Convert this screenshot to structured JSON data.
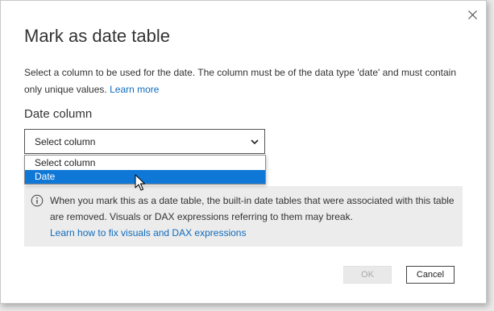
{
  "dialog": {
    "title": "Mark as date table",
    "description": "Select a column to be used for the date. The column must be of the data type 'date' and must contain only unique values.",
    "learn_more": "Learn more",
    "close_icon": "close-icon"
  },
  "date_column": {
    "label": "Date column",
    "selected_value": "Select column",
    "options": [
      "Select column",
      "Date"
    ],
    "highlighted_option": "Date"
  },
  "info": {
    "icon": "info-icon",
    "text": "When you mark this as a date table, the built-in date tables that were associated with this table are removed. Visuals or DAX expressions referring to them may break.",
    "link": "Learn how to fix visuals and DAX expressions"
  },
  "buttons": {
    "ok": "OK",
    "ok_enabled": false,
    "cancel": "Cancel"
  },
  "colors": {
    "accent": "#0f78d7",
    "link": "#0f6cbd",
    "info_background": "#ececec"
  }
}
